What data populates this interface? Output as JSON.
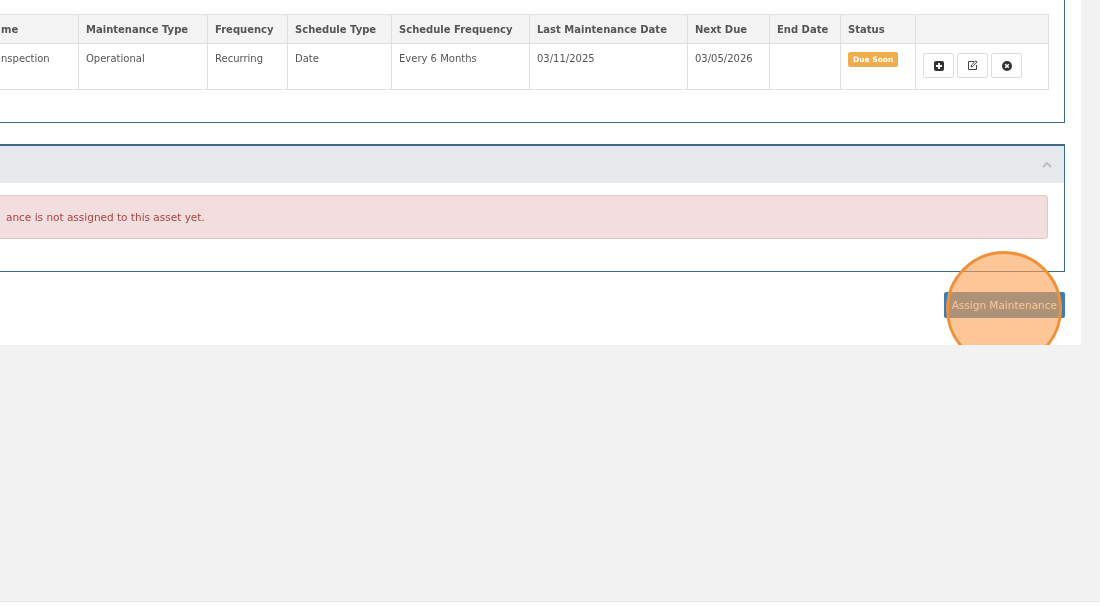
{
  "schedule_table": {
    "columns": [
      "me",
      "Maintenance Type",
      "Frequency",
      "Schedule Type",
      "Schedule Frequency",
      "Last Maintenance Date",
      "Next Due",
      "End Date",
      "Status",
      ""
    ],
    "rows": [
      {
        "cells": [
          "nspection",
          "Operational",
          "Recurring",
          "Date",
          "Every 6 Months",
          "03/11/2025",
          "03/05/2026",
          ""
        ],
        "status": {
          "label": "Due Soon",
          "color": "#f0ad4e"
        }
      }
    ]
  },
  "second_panel": {
    "expanded": true,
    "alert": "ance is not assigned to this asset yet."
  },
  "assign_button": {
    "label": "Assign Maintenance",
    "highlighted": true
  }
}
